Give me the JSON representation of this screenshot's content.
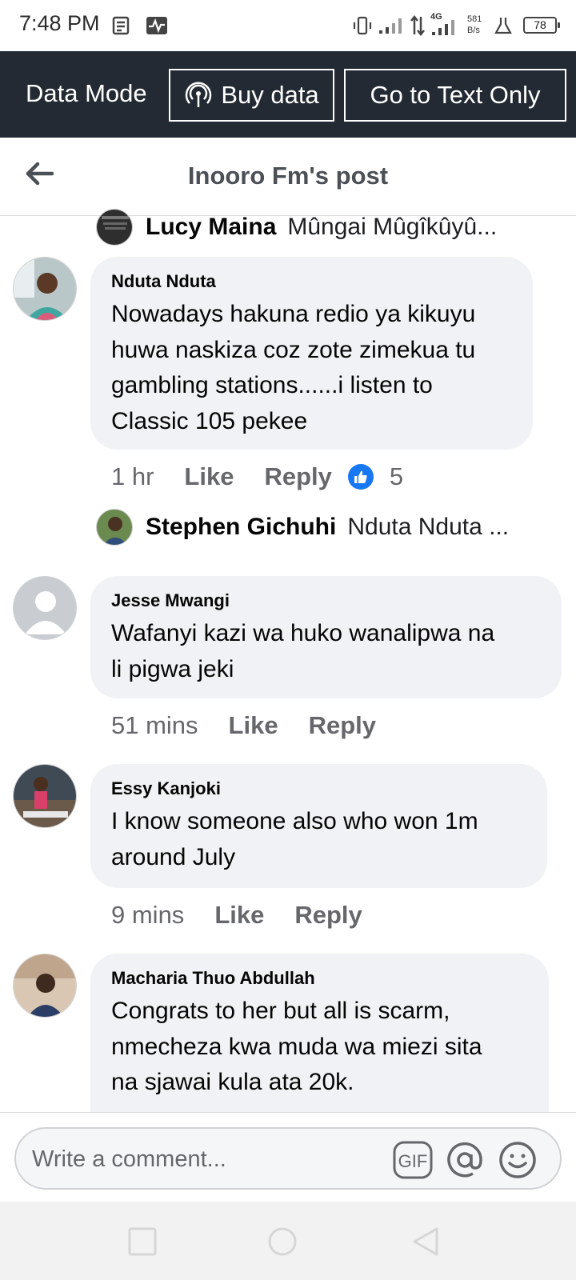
{
  "status_bar": {
    "time": "7:48 PM",
    "network_type": "4G",
    "speed_value": "581",
    "speed_unit": "B/s",
    "battery": "78"
  },
  "data_bar": {
    "mode_label": "Data Mode",
    "buy_data_label": "Buy data",
    "text_only_label": "Go to Text Only"
  },
  "header": {
    "title": "Inooro Fm's post"
  },
  "replies": [
    {
      "name": "Lucy Maina",
      "text": "Mûngai Mûgîkûyû..."
    },
    {
      "name": "Stephen Gichuhi",
      "text": "Nduta Nduta ..."
    }
  ],
  "comments": [
    {
      "name": "Nduta Nduta",
      "lines": [
        "Nowadays hakuna redio ya kikuyu",
        "huwa naskiza coz zote zimekua tu",
        "gambling stations......i listen to",
        "Classic 105 pekee"
      ],
      "time": "1 hr",
      "like_label": "Like",
      "reply_label": "Reply",
      "reactions": "5"
    },
    {
      "name": "Jesse Mwangi",
      "lines": [
        "Wafanyi kazi wa huko wanalipwa na",
        "li pigwa jeki"
      ],
      "time": "51 mins",
      "like_label": "Like",
      "reply_label": "Reply"
    },
    {
      "name": "Essy Kanjoki",
      "lines": [
        "I know someone also who won 1m",
        "around July"
      ],
      "time": "9 mins",
      "like_label": "Like",
      "reply_label": "Reply"
    },
    {
      "name": "Macharia Thuo Abdullah",
      "lines": [
        "Congrats to her but all is scarm,",
        "nmecheza kwa muda wa miezi sita",
        "na sjawai kula ata 20k."
      ]
    }
  ],
  "composer": {
    "placeholder": "Write a comment...",
    "gif_label": "GIF"
  },
  "colors": {
    "data_bar_bg": "#242a33",
    "bubble_bg": "#f0f2f5",
    "like_blue": "#1877f2",
    "meta_gray": "#65676b"
  },
  "icons": [
    "back-arrow-icon",
    "broadcast-icon",
    "thumbs-up-icon",
    "gif-icon",
    "mention-icon",
    "emoji-icon",
    "square-nav-icon",
    "circle-nav-icon",
    "triangle-nav-icon"
  ]
}
